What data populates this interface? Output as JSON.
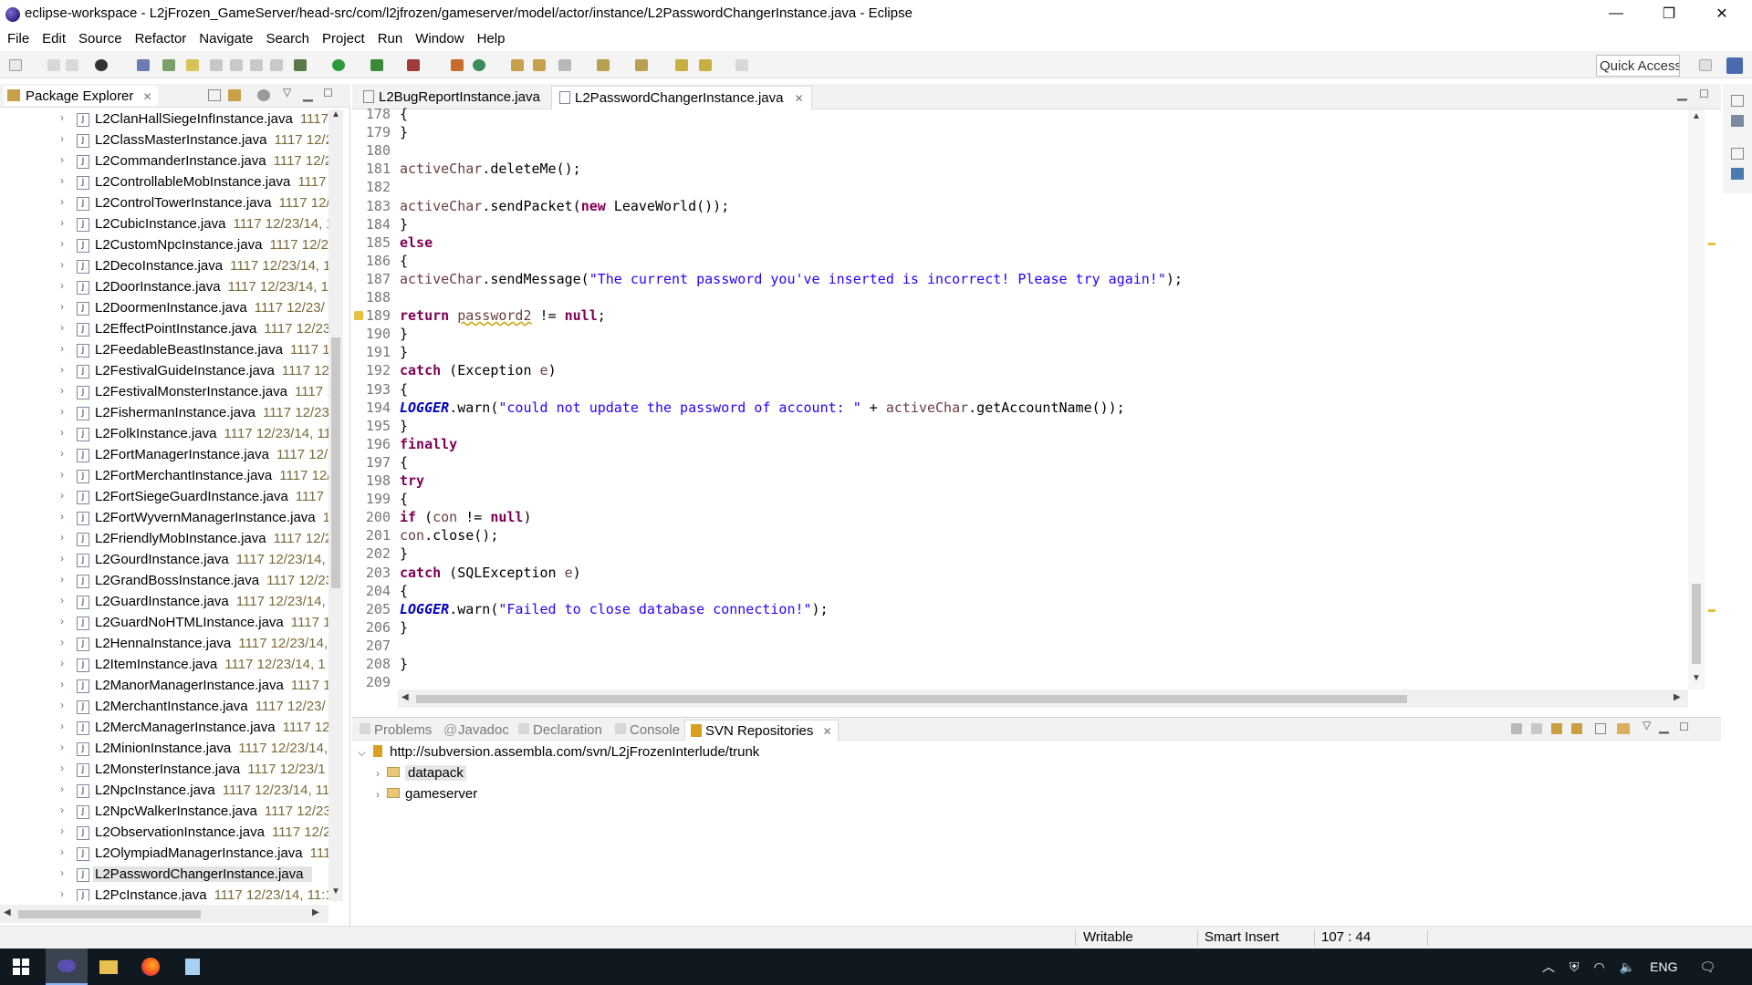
{
  "window": {
    "title": "eclipse-workspace - L2jFrozen_GameServer/head-src/com/l2jfrozen/gameserver/model/actor/instance/L2PasswordChangerInstance.java - Eclipse",
    "minimize": "—",
    "restore": "❐",
    "close": "✕"
  },
  "menu": [
    "File",
    "Edit",
    "Source",
    "Refactor",
    "Navigate",
    "Search",
    "Project",
    "Run",
    "Window",
    "Help"
  ],
  "quick_access": "Quick Access",
  "package_explorer": {
    "title": "Package Explorer",
    "close_glyph": "✕",
    "items": [
      {
        "name": "L2ClanHallSiegeInfInstance.java",
        "meta": "1117"
      },
      {
        "name": "L2ClassMasterInstance.java",
        "meta": "1117  12/2"
      },
      {
        "name": "L2CommanderInstance.java",
        "meta": "1117  12/2"
      },
      {
        "name": "L2ControllableMobInstance.java",
        "meta": "1117"
      },
      {
        "name": "L2ControlTowerInstance.java",
        "meta": "1117  12/"
      },
      {
        "name": "L2CubicInstance.java",
        "meta": "1117  12/23/14, 1"
      },
      {
        "name": "L2CustomNpcInstance.java",
        "meta": "1117  12/2"
      },
      {
        "name": "L2DecoInstance.java",
        "meta": "1117  12/23/14, 1"
      },
      {
        "name": "L2DoorInstance.java",
        "meta": "1117  12/23/14, 1"
      },
      {
        "name": "L2DoormenInstance.java",
        "meta": "1117  12/23/"
      },
      {
        "name": "L2EffectPointInstance.java",
        "meta": "1117  12/23"
      },
      {
        "name": "L2FeedableBeastInstance.java",
        "meta": "1117  12"
      },
      {
        "name": "L2FestivalGuideInstance.java",
        "meta": "1117  12/"
      },
      {
        "name": "L2FestivalMonsterInstance.java",
        "meta": "1117  1"
      },
      {
        "name": "L2FishermanInstance.java",
        "meta": "1117  12/23/"
      },
      {
        "name": "L2FolkInstance.java",
        "meta": "1117  12/23/14, 11"
      },
      {
        "name": "L2FortManagerInstance.java",
        "meta": "1117  12/"
      },
      {
        "name": "L2FortMerchantInstance.java",
        "meta": "1117  12/"
      },
      {
        "name": "L2FortSiegeGuardInstance.java",
        "meta": "1117  1"
      },
      {
        "name": "L2FortWyvernManagerInstance.java",
        "meta": "11"
      },
      {
        "name": "L2FriendlyMobInstance.java",
        "meta": "1117  12/2"
      },
      {
        "name": "L2GourdInstance.java",
        "meta": "1117  12/23/14,"
      },
      {
        "name": "L2GrandBossInstance.java",
        "meta": "1117  12/23"
      },
      {
        "name": "L2GuardInstance.java",
        "meta": "1117  12/23/14,"
      },
      {
        "name": "L2GuardNoHTMLInstance.java",
        "meta": "1117  1"
      },
      {
        "name": "L2HennaInstance.java",
        "meta": "1117  12/23/14,"
      },
      {
        "name": "L2ItemInstance.java",
        "meta": "1117  12/23/14, 1"
      },
      {
        "name": "L2ManorManagerInstance.java",
        "meta": "1117  1"
      },
      {
        "name": "L2MerchantInstance.java",
        "meta": "1117  12/23/"
      },
      {
        "name": "L2MercManagerInstance.java",
        "meta": "1117  12"
      },
      {
        "name": "L2MinionInstance.java",
        "meta": "1117  12/23/14,"
      },
      {
        "name": "L2MonsterInstance.java",
        "meta": "1117  12/23/1"
      },
      {
        "name": "L2NpcInstance.java",
        "meta": "1117  12/23/14, 11"
      },
      {
        "name": "L2NpcWalkerInstance.java",
        "meta": "1117  12/23"
      },
      {
        "name": "L2ObservationInstance.java",
        "meta": "1117  12/2"
      },
      {
        "name": "L2OlympiadManagerInstance.java",
        "meta": "111"
      },
      {
        "name": "L2PasswordChangerInstance.java",
        "meta": ""
      },
      {
        "name": "L2PcInstance.java",
        "meta": "1117  12/23/14, 11:1"
      }
    ]
  },
  "editor": {
    "tabs": [
      {
        "label": "L2BugReportInstance.java"
      },
      {
        "label": "L2PasswordChangerInstance.java"
      }
    ],
    "close_glyph": "✕",
    "lines": [
      {
        "n": "178",
        "segs": [
          {
            "t": "{"
          }
        ]
      },
      {
        "n": "179",
        "segs": [
          {
            "t": "}"
          }
        ]
      },
      {
        "n": "180",
        "segs": []
      },
      {
        "n": "181",
        "segs": [
          {
            "t": "activeChar",
            "c": "var"
          },
          {
            "t": ".deleteMe();"
          }
        ]
      },
      {
        "n": "182",
        "segs": []
      },
      {
        "n": "183",
        "segs": [
          {
            "t": "activeChar",
            "c": "var"
          },
          {
            "t": ".sendPacket("
          },
          {
            "t": "new",
            "c": "kw"
          },
          {
            "t": " LeaveWorld());"
          }
        ]
      },
      {
        "n": "184",
        "segs": [
          {
            "t": "}"
          }
        ]
      },
      {
        "n": "185",
        "segs": [
          {
            "t": "else",
            "c": "kw"
          }
        ]
      },
      {
        "n": "186",
        "segs": [
          {
            "t": "{"
          }
        ]
      },
      {
        "n": "187",
        "segs": [
          {
            "t": "activeChar",
            "c": "var"
          },
          {
            "t": ".sendMessage("
          },
          {
            "t": "\"The current password you've inserted is incorrect! Please try again!\"",
            "c": "str"
          },
          {
            "t": ");"
          }
        ]
      },
      {
        "n": "188",
        "segs": []
      },
      {
        "n": "189",
        "segs": [
          {
            "t": "return",
            "c": "kw"
          },
          {
            "t": " "
          },
          {
            "t": "password2",
            "c": "var warn-ul"
          },
          {
            "t": " != "
          },
          {
            "t": "null",
            "c": "kw"
          },
          {
            "t": ";"
          }
        ]
      },
      {
        "n": "190",
        "segs": [
          {
            "t": "}"
          }
        ]
      },
      {
        "n": "191",
        "segs": [
          {
            "t": "}"
          }
        ]
      },
      {
        "n": "192",
        "segs": [
          {
            "t": "catch",
            "c": "kw"
          },
          {
            "t": " (Exception "
          },
          {
            "t": "e",
            "c": "var"
          },
          {
            "t": ")"
          }
        ]
      },
      {
        "n": "193",
        "segs": [
          {
            "t": "{"
          }
        ]
      },
      {
        "n": "194",
        "segs": [
          {
            "t": "LOGGER",
            "c": "fld"
          },
          {
            "t": ".warn("
          },
          {
            "t": "\"could not update the password of account: \"",
            "c": "str"
          },
          {
            "t": " + "
          },
          {
            "t": "activeChar",
            "c": "var"
          },
          {
            "t": ".getAccountName());"
          }
        ]
      },
      {
        "n": "195",
        "segs": [
          {
            "t": "}"
          }
        ]
      },
      {
        "n": "196",
        "segs": [
          {
            "t": "finally",
            "c": "kw"
          }
        ]
      },
      {
        "n": "197",
        "segs": [
          {
            "t": "{"
          }
        ]
      },
      {
        "n": "198",
        "segs": [
          {
            "t": "try",
            "c": "kw"
          }
        ]
      },
      {
        "n": "199",
        "segs": [
          {
            "t": "{"
          }
        ]
      },
      {
        "n": "200",
        "segs": [
          {
            "t": "if",
            "c": "kw"
          },
          {
            "t": " ("
          },
          {
            "t": "con",
            "c": "var"
          },
          {
            "t": " != "
          },
          {
            "t": "null",
            "c": "kw"
          },
          {
            "t": ")"
          }
        ]
      },
      {
        "n": "201",
        "segs": [
          {
            "t": "con",
            "c": "var"
          },
          {
            "t": ".close();"
          }
        ]
      },
      {
        "n": "202",
        "segs": [
          {
            "t": "}"
          }
        ]
      },
      {
        "n": "203",
        "segs": [
          {
            "t": "catch",
            "c": "kw"
          },
          {
            "t": " (SQLException "
          },
          {
            "t": "e",
            "c": "var"
          },
          {
            "t": ")"
          }
        ]
      },
      {
        "n": "204",
        "segs": [
          {
            "t": "{"
          }
        ]
      },
      {
        "n": "205",
        "segs": [
          {
            "t": "LOGGER",
            "c": "fld"
          },
          {
            "t": ".warn("
          },
          {
            "t": "\"Failed to close database connection!\"",
            "c": "str"
          },
          {
            "t": ");"
          }
        ]
      },
      {
        "n": "206",
        "segs": [
          {
            "t": "}"
          }
        ]
      },
      {
        "n": "207",
        "segs": []
      },
      {
        "n": "208",
        "segs": [
          {
            "t": "}"
          }
        ]
      },
      {
        "n": "209",
        "segs": []
      }
    ]
  },
  "bottom": {
    "tabs": [
      {
        "label": "Problems"
      },
      {
        "label": "Javadoc"
      },
      {
        "label": "Declaration"
      },
      {
        "label": "Console"
      },
      {
        "label": "SVN Repositories"
      }
    ],
    "close_glyph": "✕",
    "repo_url": "http://subversion.assembla.com/svn/L2jFrozenInterlude/trunk",
    "children": [
      "datapack",
      "gameserver"
    ]
  },
  "status": {
    "writable": "Writable",
    "insert_mode": "Smart Insert",
    "position": "107 : 44"
  },
  "tray": {
    "language": "ENG"
  },
  "colors": {
    "keyword": "#7f0055",
    "string": "#2a00ff",
    "field": "#0000c0",
    "local_var": "#6a3e3e"
  }
}
